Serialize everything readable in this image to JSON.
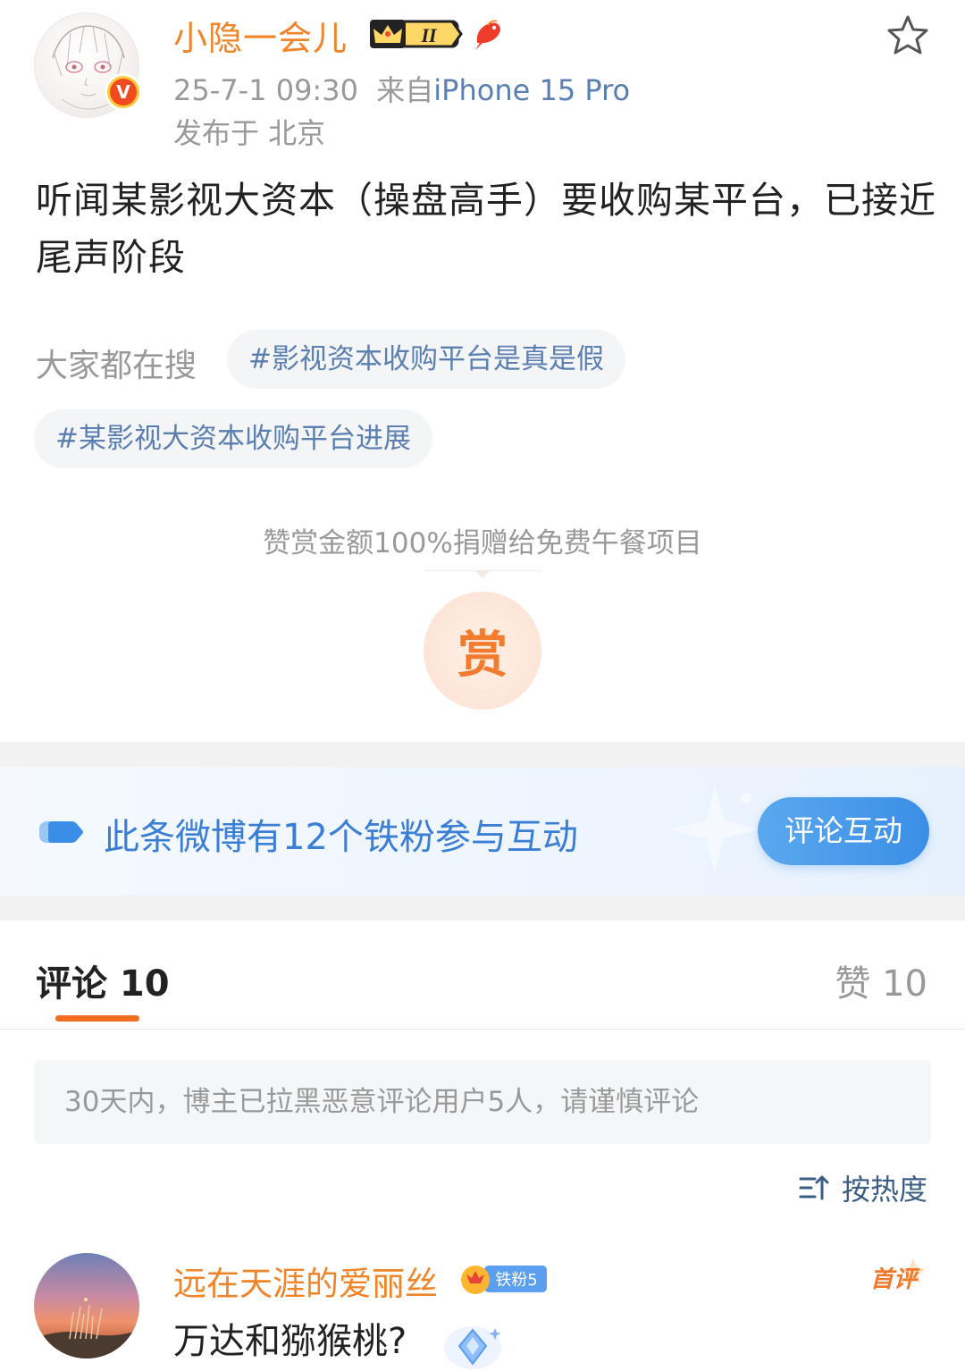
{
  "post": {
    "username": "小隐一会儿",
    "level_badge": "II",
    "timestamp": "25-7-1 09:30",
    "source_prefix": "来自",
    "device": "iPhone 15 Pro",
    "location": "发布于 北京",
    "verified_mark": "V",
    "text": "听闻某影视大资本（操盘高手）要收购某平台，已接近尾声阶段"
  },
  "trending": {
    "label": "大家都在搜",
    "tags": [
      "#影视资本收购平台是真是假",
      "#某影视大资本收购平台进展"
    ]
  },
  "reward": {
    "notice": "赞赏金额100%捐赠给免费午餐项目",
    "button": "赏"
  },
  "fans_bar": {
    "text": "此条微博有12个铁粉参与互动",
    "button": "评论互动"
  },
  "tabs": {
    "comments": "评论 10",
    "likes": "赞 10"
  },
  "notice": "30天内，博主已拉黑恶意评论用户5人，请谨慎评论",
  "sort": {
    "label": "按热度"
  },
  "comment": {
    "username": "远在天涯的爱丽丝",
    "fan_badge": "铁粉5",
    "first_label": "首评",
    "text": "万达和猕猴桃?"
  },
  "colors": {
    "accent_orange": "#f08428",
    "link_blue": "#5a7fb0",
    "fans_blue": "#3a7fd5",
    "tab_underline": "#f26d22"
  }
}
